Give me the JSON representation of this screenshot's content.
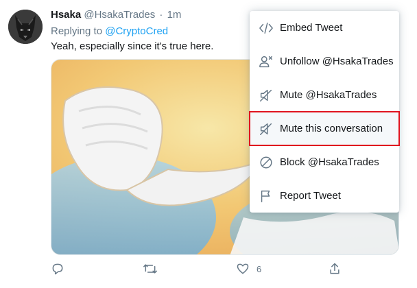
{
  "tweet": {
    "author_name": "Hsaka",
    "author_handle": "@HsakaTrades",
    "separator": "·",
    "time": "1m",
    "replying_prefix": "Replying to",
    "replying_to": "@CryptoCred",
    "text": "Yeah, especially since it's true here."
  },
  "actions": {
    "reply_icon": "reply-icon",
    "retweet_icon": "retweet-icon",
    "like_icon": "heart-icon",
    "like_count": "6",
    "share_icon": "share-icon"
  },
  "menu": {
    "items": [
      {
        "label": "Embed Tweet",
        "icon": "code-icon"
      },
      {
        "label": "Unfollow @HsakaTrades",
        "icon": "unfollow-icon"
      },
      {
        "label": "Mute @HsakaTrades",
        "icon": "mute-icon"
      },
      {
        "label": "Mute this conversation",
        "icon": "mute-icon",
        "highlighted": true
      },
      {
        "label": "Block @HsakaTrades",
        "icon": "block-icon"
      },
      {
        "label": "Report Tweet",
        "icon": "flag-icon"
      }
    ]
  },
  "colors": {
    "link": "#1da1f2",
    "secondary_text": "#657786",
    "highlight_outline": "#e0141e",
    "icon": "#657786"
  }
}
